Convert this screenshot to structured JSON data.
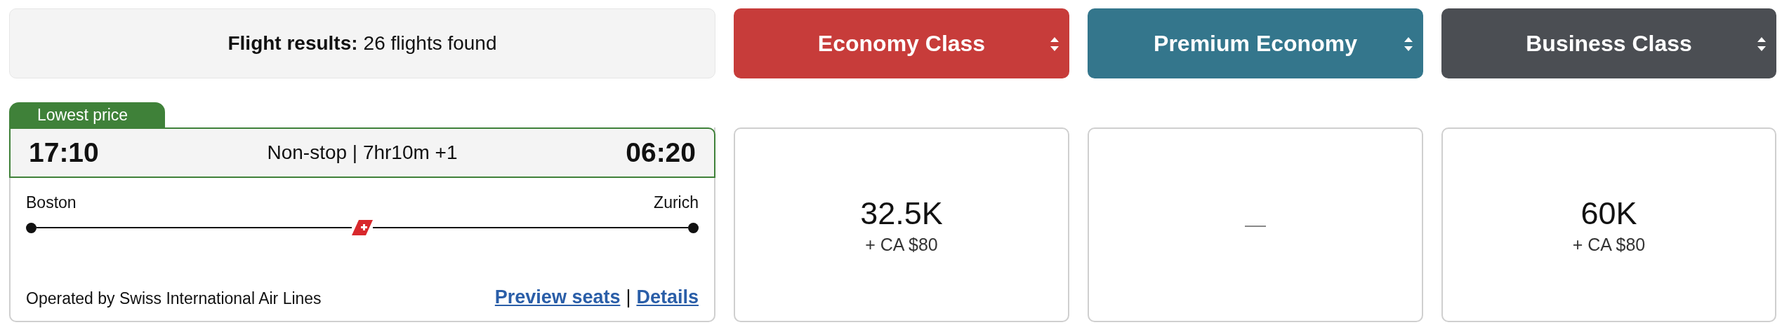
{
  "summary": {
    "label": "Flight results:",
    "value": "26 flights found"
  },
  "fare_classes": [
    {
      "label": "Economy Class",
      "color": "#c73c3a"
    },
    {
      "label": "Premium Economy",
      "color": "#34768c"
    },
    {
      "label": "Business Class",
      "color": "#4b4e53"
    }
  ],
  "flight": {
    "badge": "Lowest price",
    "depart_time": "17:10",
    "stops_duration": "Non-stop | 7hr10m +1",
    "arrive_time": "06:20",
    "origin": "Boston",
    "destination": "Zurich",
    "operator": "Operated by Swiss International Air Lines",
    "links": [
      "Preview seats",
      "Details"
    ],
    "link_separator": "|"
  },
  "prices": [
    {
      "amount": "32.5K",
      "fees": "+ CA $80"
    },
    {
      "amount": "—"
    },
    {
      "amount": "60K",
      "fees": "+ CA $80"
    }
  ]
}
